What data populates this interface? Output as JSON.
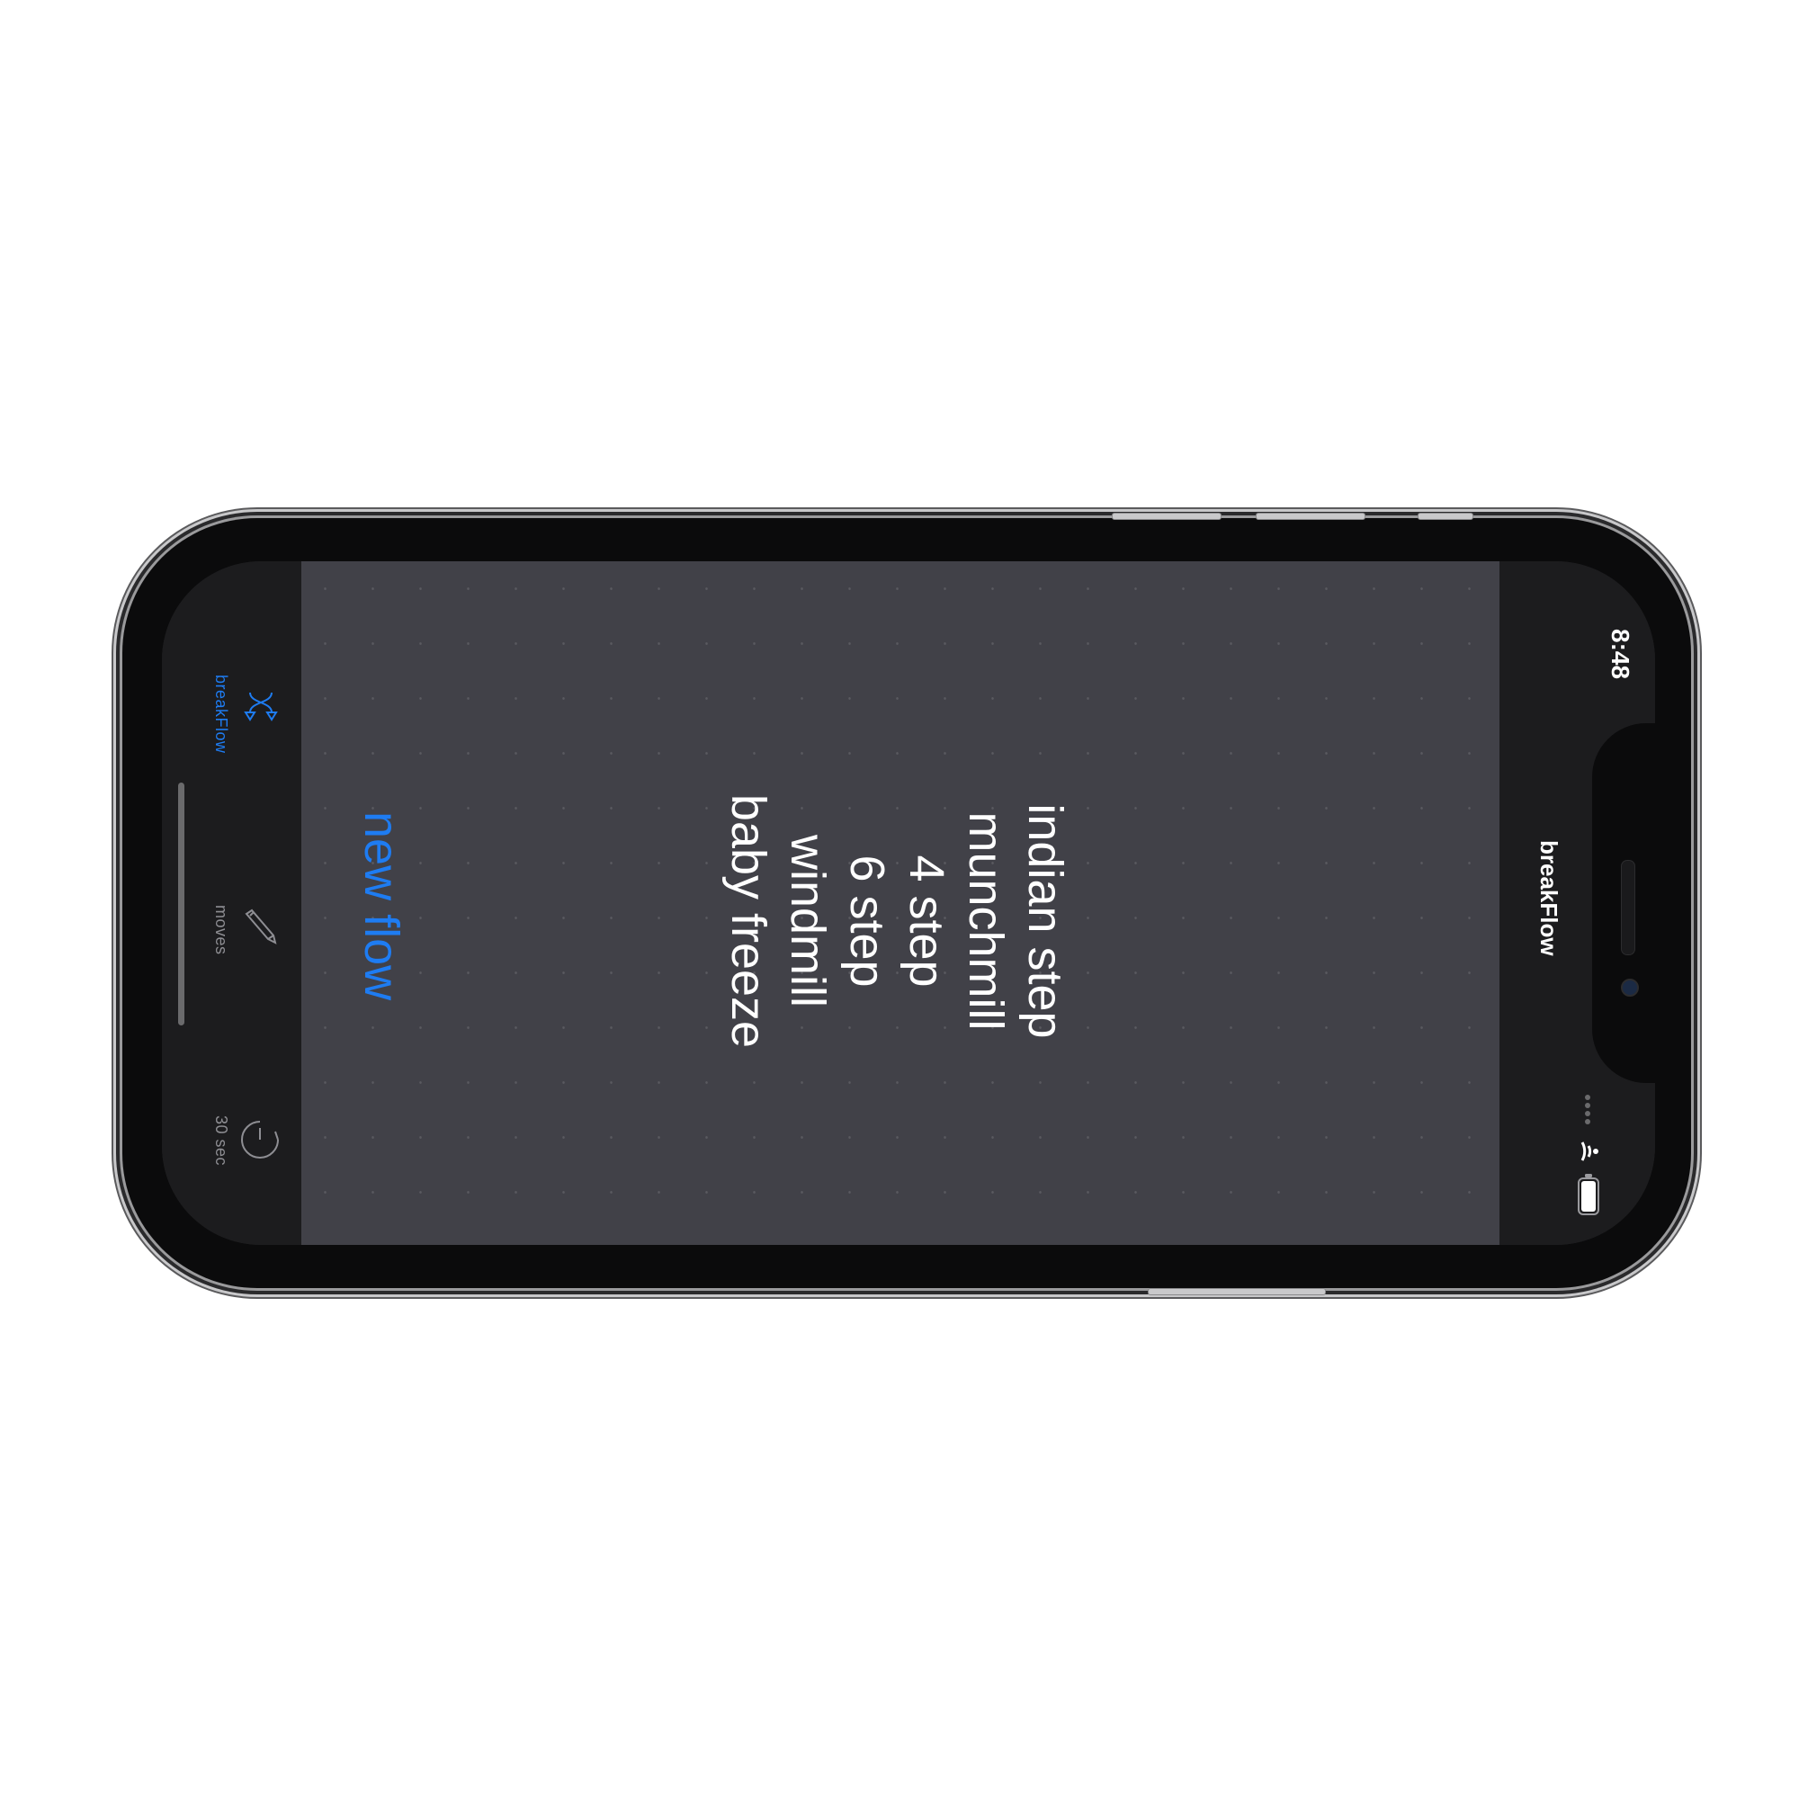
{
  "status_bar": {
    "time": "8:48",
    "signal_icon": "signal-dots-icon",
    "wifi_icon": "wifi-icon",
    "battery_icon": "battery-icon"
  },
  "nav_bar": {
    "title": "breakFlow"
  },
  "main": {
    "moves": [
      "indian step",
      "munchmill",
      "4 step",
      "6 step",
      "windmill",
      "baby freeze"
    ],
    "new_flow_button": "new flow"
  },
  "tab_bar": {
    "items": [
      {
        "label": "breakFlow",
        "icon": "shuffle-icon",
        "active": true
      },
      {
        "label": "moves",
        "icon": "pencil-icon",
        "active": false
      },
      {
        "label": "30 sec",
        "icon": "timer-icon",
        "active": false
      }
    ]
  },
  "colors": {
    "accent": "#1e7cf2",
    "content_background": "#414148",
    "bar_background": "#1c1c1e",
    "inactive": "#8e8e93"
  }
}
